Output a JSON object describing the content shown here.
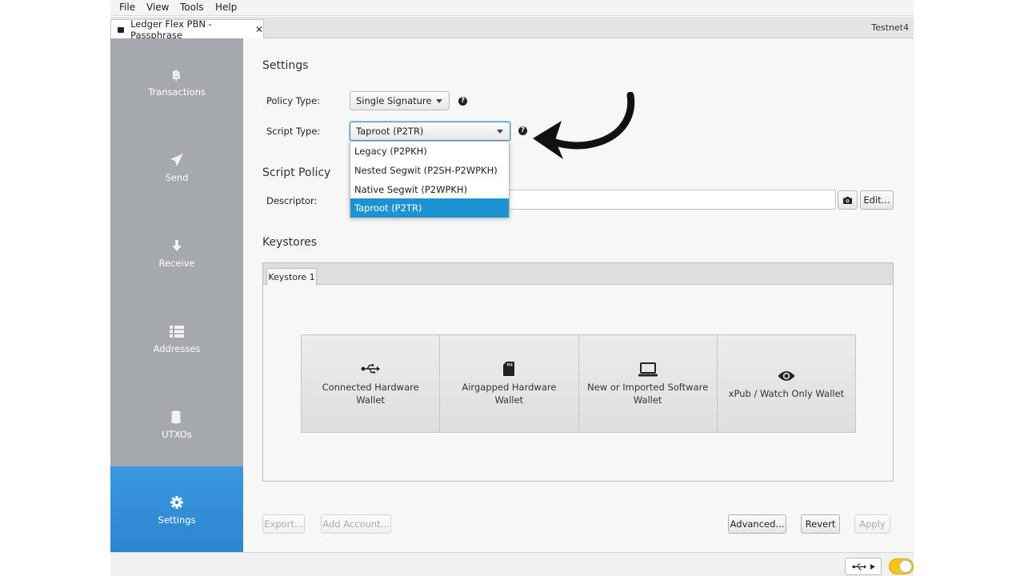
{
  "menu": {
    "items": [
      "File",
      "View",
      "Tools",
      "Help"
    ]
  },
  "tab": {
    "title": "Ledger Flex PBN - Passphrase",
    "close": "✕"
  },
  "network": "Testnet4",
  "sidebar": {
    "items": [
      {
        "label": "Transactions",
        "icon": "bitcoin-icon"
      },
      {
        "label": "Send",
        "icon": "send-icon"
      },
      {
        "label": "Receive",
        "icon": "receive-icon"
      },
      {
        "label": "Addresses",
        "icon": "addresses-icon"
      },
      {
        "label": "UTXOs",
        "icon": "coins-icon"
      },
      {
        "label": "Settings",
        "icon": "gear-icon",
        "active": true
      }
    ]
  },
  "settings": {
    "title": "Settings",
    "policy_type_label": "Policy Type:",
    "policy_type_value": "Single Signature",
    "script_type_label": "Script Type:",
    "script_type_value": "Taproot (P2TR)",
    "script_type_options": [
      "Legacy (P2PKH)",
      "Nested Segwit (P2SH-P2WPKH)",
      "Native Segwit (P2WPKH)",
      "Taproot (P2TR)"
    ],
    "script_type_selected_index": 3
  },
  "script_policy": {
    "title": "Script Policy",
    "descriptor_label": "Descriptor:",
    "descriptor_value": "",
    "edit_label": "Edit..."
  },
  "keystores": {
    "title": "Keystores",
    "tab": "Keystore 1",
    "options": [
      {
        "label": "Connected Hardware Wallet",
        "icon": "usb-icon"
      },
      {
        "label": "Airgapped Hardware Wallet",
        "icon": "sd-card-icon"
      },
      {
        "label": "New or Imported Software Wallet",
        "icon": "laptop-icon"
      },
      {
        "label": "xPub / Watch Only Wallet",
        "icon": "eye-icon"
      }
    ]
  },
  "footer": {
    "export": "Export...",
    "add_account": "Add Account...",
    "advanced": "Advanced...",
    "revert": "Revert",
    "apply": "Apply"
  },
  "colors": {
    "accent": "#2d86cf",
    "sidebar": "#a5a8ad",
    "selected": "#1d93d2",
    "toggle": "#f5c518"
  }
}
